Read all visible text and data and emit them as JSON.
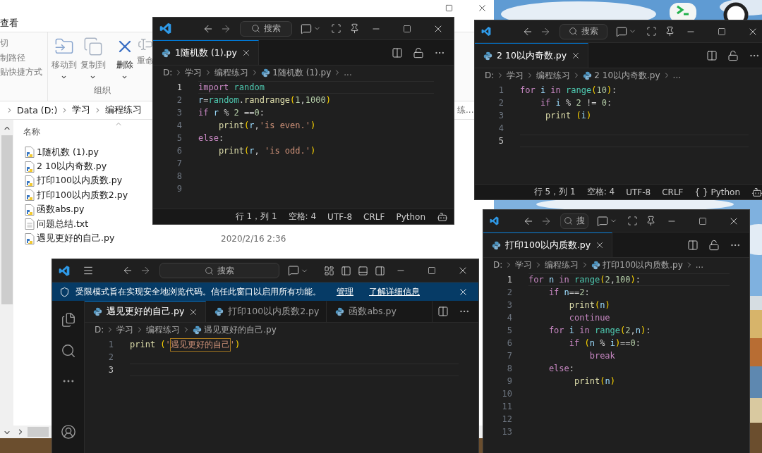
{
  "explorer": {
    "ribbon_tab": "查看",
    "clipboard_commands": [
      {
        "label": "切",
        "disabled": true
      },
      {
        "label": "制路径",
        "disabled": true
      },
      {
        "label": "贴快捷方式",
        "disabled": true
      }
    ],
    "organize": {
      "label": "组织",
      "buttons": [
        {
          "label": "移动到",
          "kind": "move",
          "disabled": true
        },
        {
          "label": "复制到",
          "kind": "copy",
          "disabled": true
        },
        {
          "label": "删除",
          "kind": "delete",
          "disabled": false
        },
        {
          "label": "重命",
          "kind": "rename",
          "disabled": true
        }
      ]
    },
    "breadcrumb": [
      "Data (D:)",
      "学习",
      "编程练习"
    ],
    "search_placeholder": "练...",
    "column_header": "名称",
    "files": [
      {
        "name": "1随机数 (1).py",
        "kind": "python"
      },
      {
        "name": "2 10以内奇数.py",
        "kind": "python"
      },
      {
        "name": "打印100以内质数.py",
        "kind": "python"
      },
      {
        "name": "打印100以内质数2.py",
        "kind": "python"
      },
      {
        "name": "函数abs.py",
        "kind": "python"
      },
      {
        "name": "问题总结.txt",
        "kind": "text"
      },
      {
        "name": "遇见更好的自己.py",
        "kind": "python",
        "modified": "2020/2/16 2:36"
      }
    ]
  },
  "editors": [
    {
      "kind": "compact",
      "search_placeholder": "搜索",
      "tabs": [
        {
          "label": "1随机数 (1).py",
          "selected": true
        }
      ],
      "path": [
        "D:",
        "学习",
        "编程练习"
      ],
      "file": "1随机数 (1).py",
      "more": "...",
      "lines": [
        {
          "number": "1",
          "current": true,
          "tokens": [
            {
              "text": "import",
              "kind": "keyword"
            },
            {
              "text": " random",
              "kind": "module"
            }
          ]
        },
        {
          "number": "2",
          "current": false,
          "tokens": [
            {
              "text": "r",
              "kind": "variable"
            },
            {
              "text": "=",
              "kind": "plain"
            },
            {
              "text": "random",
              "kind": "module"
            },
            {
              "text": ".",
              "kind": "plain"
            },
            {
              "text": "randrange",
              "kind": "function"
            },
            {
              "text": "(",
              "kind": "paren"
            },
            {
              "text": "1",
              "kind": "number"
            },
            {
              "text": ",",
              "kind": "plain"
            },
            {
              "text": "1000",
              "kind": "number"
            },
            {
              "text": ")",
              "kind": "paren"
            }
          ]
        },
        {
          "number": "3",
          "current": false,
          "tokens": [
            {
              "text": "if",
              "kind": "keyword"
            },
            {
              "text": " r",
              "kind": "variable"
            },
            {
              "text": " % ",
              "kind": "plain"
            },
            {
              "text": "2",
              "kind": "number"
            },
            {
              "text": " ==",
              "kind": "plain"
            },
            {
              "text": "0",
              "kind": "number"
            },
            {
              "text": ":",
              "kind": "plain"
            }
          ]
        },
        {
          "number": "4",
          "current": false,
          "tokens": [
            {
              "text": "    print",
              "kind": "function"
            },
            {
              "text": "(",
              "kind": "paren"
            },
            {
              "text": "r",
              "kind": "variable"
            },
            {
              "text": ",",
              "kind": "plain"
            },
            {
              "text": "'is even.'",
              "kind": "string"
            },
            {
              "text": ")",
              "kind": "paren"
            }
          ]
        },
        {
          "number": "5",
          "current": false,
          "tokens": [
            {
              "text": "else",
              "kind": "keyword"
            },
            {
              "text": ":",
              "kind": "plain"
            }
          ]
        },
        {
          "number": "6",
          "current": false,
          "tokens": [
            {
              "text": "    print",
              "kind": "function"
            },
            {
              "text": "(",
              "kind": "paren"
            },
            {
              "text": "r",
              "kind": "variable"
            },
            {
              "text": ", ",
              "kind": "plain"
            },
            {
              "text": "'is odd.'",
              "kind": "string"
            },
            {
              "text": ")",
              "kind": "paren"
            }
          ]
        },
        {
          "number": "7",
          "current": false
        },
        {
          "number": "8",
          "current": false
        },
        {
          "number": "9",
          "current": false
        }
      ],
      "status": [
        "行 1，列 1",
        "空格: 4",
        "UTF-8",
        "CRLF",
        "Python"
      ]
    },
    {
      "kind": "compact",
      "search_placeholder": "搜索",
      "tabs": [
        {
          "label": "2 10以内奇数.py",
          "selected": true
        }
      ],
      "path": [
        "D:",
        "学习",
        "编程练习"
      ],
      "file": "2 10以内奇数.py",
      "more": "...",
      "lines": [
        {
          "number": "1",
          "current": false,
          "tokens": [
            {
              "text": "for",
              "kind": "keyword"
            },
            {
              "text": " i",
              "kind": "variable"
            },
            {
              "text": " in",
              "kind": "keyword"
            },
            {
              "text": " range",
              "kind": "module"
            },
            {
              "text": "(",
              "kind": "paren"
            },
            {
              "text": "10",
              "kind": "number"
            },
            {
              "text": ")",
              "kind": "paren"
            },
            {
              "text": ":",
              "kind": "plain"
            }
          ]
        },
        {
          "number": "2",
          "current": false,
          "tokens": [
            {
              "text": "    if",
              "kind": "keyword"
            },
            {
              "text": " i",
              "kind": "variable"
            },
            {
              "text": " % ",
              "kind": "plain"
            },
            {
              "text": "2",
              "kind": "number"
            },
            {
              "text": " != ",
              "kind": "plain"
            },
            {
              "text": "0",
              "kind": "number"
            },
            {
              "text": ":",
              "kind": "plain"
            }
          ]
        },
        {
          "number": "3",
          "current": false,
          "tokens": [
            {
              "text": "     print ",
              "kind": "function"
            },
            {
              "text": "(",
              "kind": "paren"
            },
            {
              "text": "i",
              "kind": "variable"
            },
            {
              "text": ")",
              "kind": "paren"
            }
          ]
        },
        {
          "number": "4",
          "current": false
        },
        {
          "number": "5",
          "current": true
        }
      ],
      "status": [
        "行 5，列 1",
        "空格: 4",
        "UTF-8",
        "CRLF",
        "{ } Python"
      ]
    },
    {
      "kind": "compact",
      "search_placeholder": "搜",
      "tabs": [
        {
          "label": "打印100以内质数.py",
          "selected": true
        }
      ],
      "path": [
        "D:",
        "学习",
        "编程练习"
      ],
      "file": "打印100以内质数.py",
      "more": "...",
      "lines": [
        {
          "number": "1",
          "current": true,
          "tokens": [
            {
              "text": "for",
              "kind": "keyword"
            },
            {
              "text": " n",
              "kind": "variable"
            },
            {
              "text": " in",
              "kind": "keyword"
            },
            {
              "text": " range",
              "kind": "module"
            },
            {
              "text": "(",
              "kind": "paren"
            },
            {
              "text": "2",
              "kind": "number"
            },
            {
              "text": ",",
              "kind": "plain"
            },
            {
              "text": "100",
              "kind": "number"
            },
            {
              "text": ")",
              "kind": "paren"
            },
            {
              "text": ":",
              "kind": "plain"
            }
          ]
        },
        {
          "number": "2",
          "current": false,
          "tokens": [
            {
              "text": "    if",
              "kind": "keyword"
            },
            {
              "text": " n",
              "kind": "variable"
            },
            {
              "text": "==",
              "kind": "plain"
            },
            {
              "text": "2",
              "kind": "number"
            },
            {
              "text": ":",
              "kind": "plain"
            }
          ]
        },
        {
          "number": "3",
          "current": false,
          "tokens": [
            {
              "text": "        print",
              "kind": "function"
            },
            {
              "text": "(",
              "kind": "paren"
            },
            {
              "text": "n",
              "kind": "variable"
            },
            {
              "text": ")",
              "kind": "paren"
            }
          ]
        },
        {
          "number": "4",
          "current": false,
          "tokens": [
            {
              "text": "        continue",
              "kind": "keyword"
            }
          ]
        },
        {
          "number": "5",
          "current": false,
          "tokens": [
            {
              "text": "    for",
              "kind": "keyword"
            },
            {
              "text": " i",
              "kind": "variable"
            },
            {
              "text": " in",
              "kind": "keyword"
            },
            {
              "text": " range",
              "kind": "module"
            },
            {
              "text": "(",
              "kind": "paren"
            },
            {
              "text": "2",
              "kind": "number"
            },
            {
              "text": ",",
              "kind": "plain"
            },
            {
              "text": "n",
              "kind": "variable"
            },
            {
              "text": ")",
              "kind": "paren"
            },
            {
              "text": ":",
              "kind": "plain"
            }
          ]
        },
        {
          "number": "6",
          "current": false,
          "tokens": [
            {
              "text": "        if ",
              "kind": "keyword"
            },
            {
              "text": "(",
              "kind": "paren"
            },
            {
              "text": "n",
              "kind": "variable"
            },
            {
              "text": " % ",
              "kind": "plain"
            },
            {
              "text": "i",
              "kind": "variable"
            },
            {
              "text": ")",
              "kind": "paren"
            },
            {
              "text": "==",
              "kind": "plain"
            },
            {
              "text": "0",
              "kind": "number"
            },
            {
              "text": ":",
              "kind": "plain"
            }
          ]
        },
        {
          "number": "7",
          "current": false,
          "tokens": [
            {
              "text": "            break",
              "kind": "keyword"
            }
          ]
        },
        {
          "number": "8",
          "current": false,
          "tokens": [
            {
              "text": "    else",
              "kind": "keyword"
            },
            {
              "text": ":",
              "kind": "plain"
            }
          ]
        },
        {
          "number": "9",
          "current": false,
          "tokens": [
            {
              "text": "         print",
              "kind": "function"
            },
            {
              "text": "(",
              "kind": "paren"
            },
            {
              "text": "n",
              "kind": "variable"
            },
            {
              "text": ")",
              "kind": "paren"
            }
          ]
        },
        {
          "number": "10",
          "current": false
        },
        {
          "number": "11",
          "current": false
        },
        {
          "number": "12",
          "current": false
        },
        {
          "number": "13",
          "current": false
        }
      ]
    },
    {
      "kind": "full",
      "search_placeholder": "搜索",
      "banner": {
        "message": "受限模式旨在实现安全地浏览代码。信任此窗口以启用所有功能。",
        "links": [
          "管理",
          "了解详细信息"
        ]
      },
      "tabs": [
        {
          "label": "遇见更好的自己.py",
          "selected": true
        },
        {
          "label": "打印100以内质数2.py",
          "selected": false
        },
        {
          "label": "函数abs.py",
          "selected": false
        }
      ],
      "path": [
        "D:",
        "学习",
        "编程练习"
      ],
      "file": "遇见更好的自己.py",
      "lines": [
        {
          "number": "1",
          "current": false,
          "tokens": [
            {
              "text": "print ",
              "kind": "function"
            },
            {
              "text": "(",
              "kind": "paren"
            },
            {
              "text": "'",
              "kind": "string"
            },
            {
              "text": "遇见更好的自己",
              "kind": "highlight"
            },
            {
              "text": "'",
              "kind": "string"
            },
            {
              "text": ")",
              "kind": "paren"
            }
          ]
        },
        {
          "number": "2",
          "current": false
        },
        {
          "number": "3",
          "current": true
        }
      ]
    }
  ]
}
